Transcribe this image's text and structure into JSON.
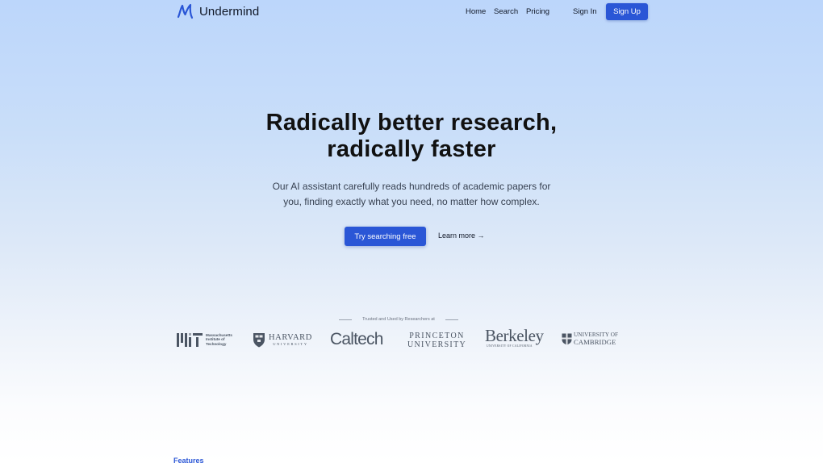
{
  "brand": {
    "name": "Undermind",
    "logo_icon": "undermind-m-icon",
    "accent_color": "#2a56d6"
  },
  "nav": {
    "links": [
      "Home",
      "Search",
      "Pricing"
    ],
    "sign_in": "Sign In",
    "sign_up": "Sign Up"
  },
  "hero": {
    "title_line1": "Radically better research,",
    "title_line2": "radically faster",
    "subtitle_line1": "Our AI assistant carefully reads hundreds of academic papers for",
    "subtitle_line2": "you, finding exactly what you need, no matter how complex.",
    "cta_primary": "Try searching free",
    "cta_secondary": "Learn more →"
  },
  "trusted": {
    "label": "Trusted and Used by Researchers at",
    "mit": {
      "line1": "Massachusetts",
      "line2": "Institute of",
      "line3": "Technology"
    },
    "harvard": {
      "line1": "HARVARD",
      "line2": "UNIVERSITY"
    },
    "caltech": "Caltech",
    "princeton": {
      "line1": "PRINCETON",
      "line2": "UNIVERSITY"
    },
    "berkeley": {
      "line1": "Berkeley",
      "line2": "UNIVERSITY OF CALIFORNIA"
    },
    "cambridge": {
      "line1": "UNIVERSITY OF",
      "line2": "CAMBRIDGE"
    }
  },
  "features_label": "Features"
}
